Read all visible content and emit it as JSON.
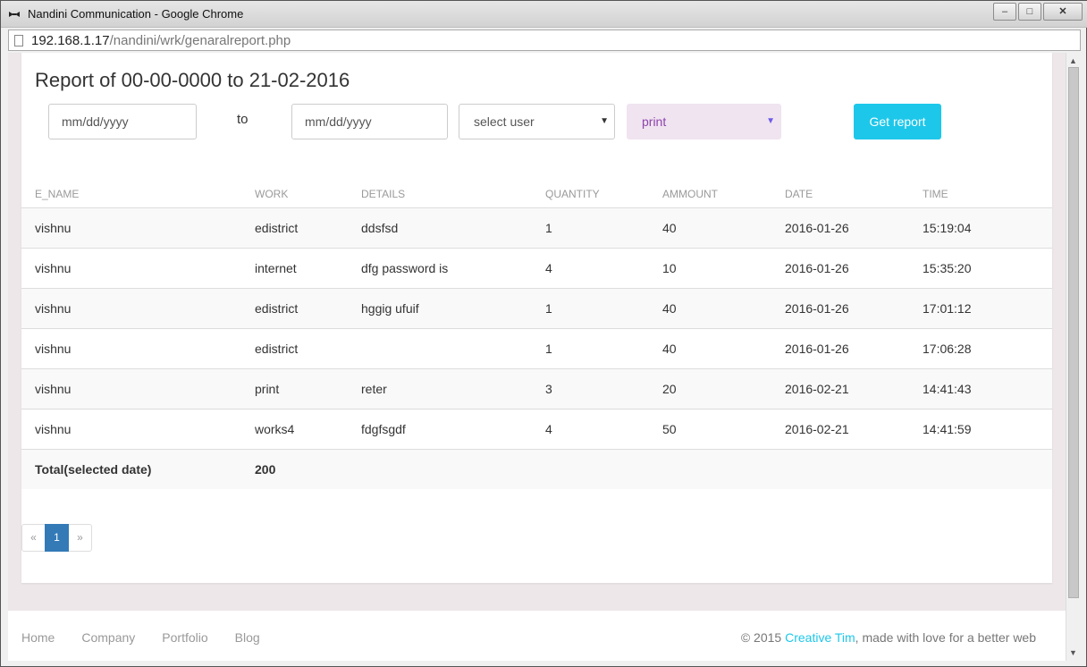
{
  "window": {
    "title": "Nandini Communication - Google Chrome"
  },
  "address": {
    "host": "192.168.1.17",
    "path": "/nandini/wrk/genaralreport.php"
  },
  "report": {
    "title": "Report of 00-00-0000 to 21-02-2016",
    "from_placeholder": "mm/dd/yyyy",
    "to_label": "to",
    "to_placeholder": "mm/dd/yyyy",
    "user_select": "select user",
    "work_select": "print",
    "button_label": "Get report"
  },
  "table": {
    "headers": [
      "E_NAME",
      "WORK",
      "DETAILS",
      "QUANTITY",
      "AMMOUNT",
      "DATE",
      "TIME"
    ],
    "rows": [
      [
        "vishnu",
        "edistrict",
        "ddsfsd",
        "1",
        "40",
        "2016-01-26",
        "15:19:04"
      ],
      [
        "vishnu",
        "internet",
        "dfg password is",
        "4",
        "10",
        "2016-01-26",
        "15:35:20"
      ],
      [
        "vishnu",
        "edistrict",
        "hggig ufuif",
        "1",
        "40",
        "2016-01-26",
        "17:01:12"
      ],
      [
        "vishnu",
        "edistrict",
        "",
        "1",
        "40",
        "2016-01-26",
        "17:06:28"
      ],
      [
        "vishnu",
        "print",
        "reter",
        "3",
        "20",
        "2016-02-21",
        "14:41:43"
      ],
      [
        "vishnu",
        "works4",
        "fdgfsgdf",
        "4",
        "50",
        "2016-02-21",
        "14:41:59"
      ]
    ],
    "total_label": "Total(selected date)",
    "total_value": "200"
  },
  "pagination": {
    "prev": "«",
    "current": "1",
    "next": "»"
  },
  "footer": {
    "nav": [
      "Home",
      "Company",
      "Portfolio",
      "Blog"
    ],
    "copyright_prefix": "© 2015 ",
    "copyright_link": "Creative Tim",
    "copyright_suffix": ", made with love for a better web"
  },
  "colors": {
    "accent": "#1dc7ea",
    "pagination_active": "#337ab7",
    "print_select_bg": "#f0e4f0"
  }
}
